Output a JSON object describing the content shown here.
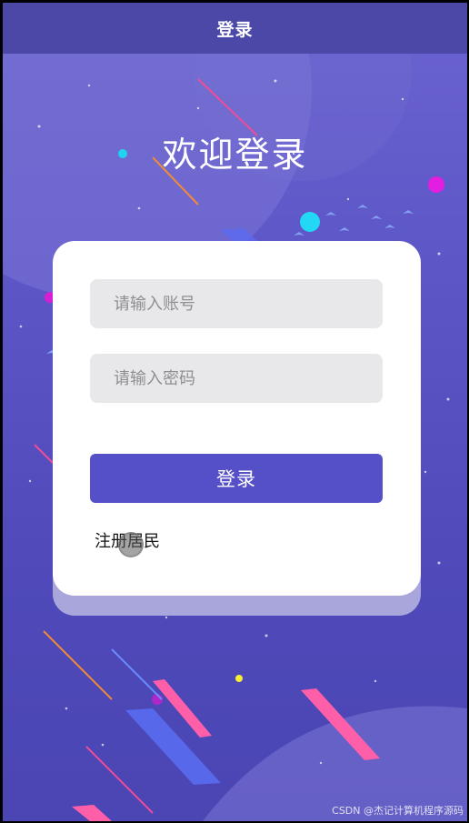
{
  "nav": {
    "title": "登录"
  },
  "welcome": "欢迎登录",
  "form": {
    "account_placeholder": "请输入账号",
    "password_placeholder": "请输入密码",
    "login_label": "登录",
    "register_label": "注册居民"
  },
  "watermark": "CSDN @杰记计算机程序源码",
  "colors": {
    "nav_bg": "#4b48a8",
    "background": "#5c55c6",
    "button": "#5550c7",
    "input_bg": "#e8e8ea"
  }
}
